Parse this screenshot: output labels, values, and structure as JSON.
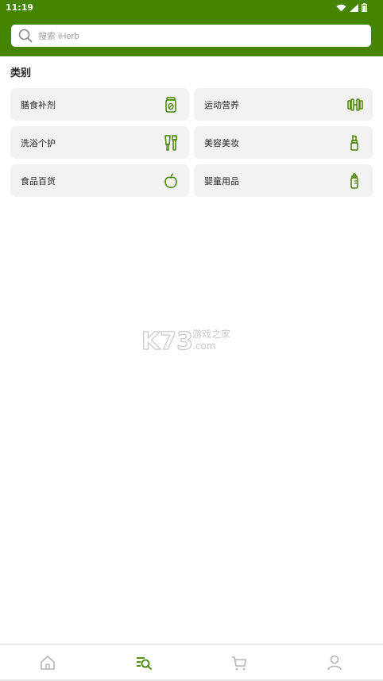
{
  "status_bar": {
    "time": "11:19"
  },
  "search": {
    "placeholder": "搜索 iHerb"
  },
  "section_title": "类别",
  "categories": [
    {
      "label": "膳食补剂",
      "icon": "supplement-bottle-icon"
    },
    {
      "label": "运动营养",
      "icon": "dumbbell-icon"
    },
    {
      "label": "洗浴个护",
      "icon": "toiletries-icon"
    },
    {
      "label": "美容美妆",
      "icon": "lipstick-icon"
    },
    {
      "label": "食品百货",
      "icon": "apple-icon"
    },
    {
      "label": "婴童用品",
      "icon": "baby-bottle-icon"
    }
  ],
  "watermark": {
    "text": "K73",
    "sub": "游戏之家",
    "domain": ".com"
  },
  "bottom_nav": [
    {
      "name": "home",
      "icon": "home-icon",
      "active": false
    },
    {
      "name": "categories",
      "icon": "category-search-icon",
      "active": true
    },
    {
      "name": "cart",
      "icon": "cart-icon",
      "active": false
    },
    {
      "name": "account",
      "icon": "person-icon",
      "active": false
    }
  ],
  "colors": {
    "brand_green": "#458500",
    "card_bg": "#f2f2f2",
    "icon_green": "#458500",
    "nav_inactive": "#b5b5b5"
  }
}
